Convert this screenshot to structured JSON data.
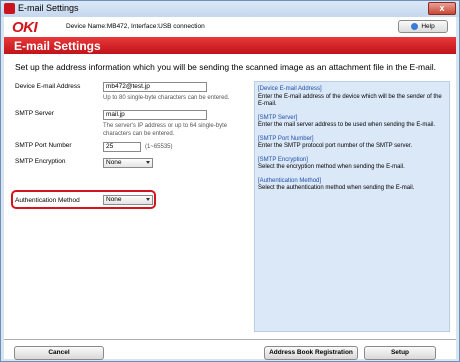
{
  "window": {
    "title": "E-mail Settings",
    "close_label": "x"
  },
  "header": {
    "logo": "OKI",
    "device_info": "Device Name:MB472, Interface:USB connection",
    "help_label": "Help"
  },
  "banner": {
    "title": "E-mail Settings"
  },
  "subtitle": "Set up the address information which you will be sending the scanned image as an attachment file in the E-mail.",
  "form": {
    "device_email": {
      "label": "Device E-mail Address",
      "value": "mb472@test.jp",
      "hint": "Up to 80 single-byte characters can be entered."
    },
    "smtp_server": {
      "label": "SMTP Server",
      "value": "mail.jp",
      "hint_line1": "The server's IP address or up to 64 single-byte",
      "hint_line2": "characters can be entered."
    },
    "smtp_port": {
      "label": "SMTP Port Number",
      "value": "25",
      "range": "(1~65535)"
    },
    "smtp_encryption": {
      "label": "SMTP Encryption",
      "value": "None"
    },
    "authentication": {
      "label": "Authentication Method",
      "value": "None"
    }
  },
  "help_panel": [
    {
      "heading": "[Device E-mail Address]",
      "body": "Enter the E-mail address of the device which will be the sender of the E-mail."
    },
    {
      "heading": "[SMTP Server]",
      "body": "Enter the mail server address to be used when sending the E-mail."
    },
    {
      "heading": "[SMTP Port Number]",
      "body": "Enter the SMTP protocol port number of the SMTP server."
    },
    {
      "heading": "[SMTP Encryption]",
      "body": "Select the encryption method when sending the E-mail."
    },
    {
      "heading": "[Authentication Method]",
      "body": "Select the authentication method when sending the E-mail."
    }
  ],
  "footer": {
    "cancel_label": "Cancel",
    "address_book_label": "Address Book Registration",
    "setup_label": "Setup"
  },
  "colors": {
    "brand_red": "#d4141c",
    "help_panel_bg": "#dbe8f7",
    "help_heading": "#1f4fa8"
  }
}
